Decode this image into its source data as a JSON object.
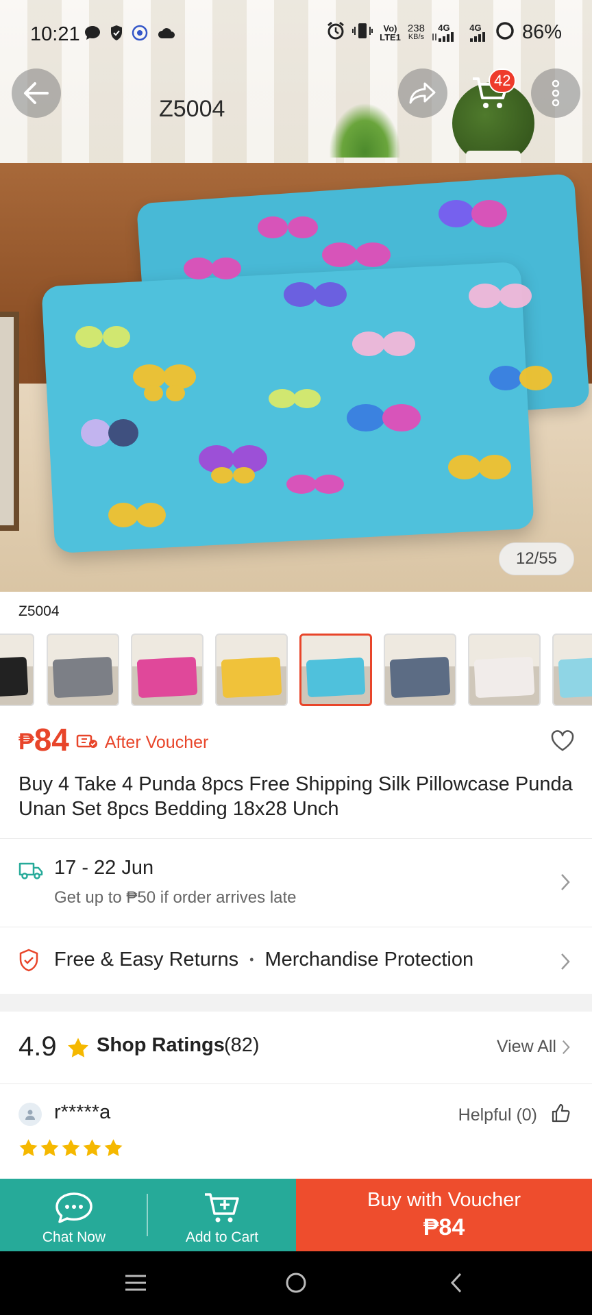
{
  "status_bar": {
    "time": "10:21",
    "battery": "86%",
    "net_speed_value": "238",
    "net_speed_unit": "KB/s",
    "volte_top": "Vo)",
    "volte_bottom": "LTE1",
    "sig1": "4G",
    "sig2": "4G"
  },
  "header": {
    "title": "Z5004",
    "cart_count": "42"
  },
  "gallery": {
    "counter": "12/55",
    "variant_label": "Z5004",
    "thumbnails": [
      {
        "color": "#222222",
        "selected": false
      },
      {
        "color": "#7c7f86",
        "selected": false
      },
      {
        "color": "#e0489a",
        "selected": false
      },
      {
        "color": "#f0c23a",
        "selected": false
      },
      {
        "color": "#4fc1dc",
        "selected": true
      },
      {
        "color": "#5c6c84",
        "selected": false
      },
      {
        "color": "#f1ecea",
        "selected": false
      },
      {
        "color": "#8fd5e5",
        "selected": false
      }
    ]
  },
  "price": {
    "currency": "₱",
    "value": "84",
    "after_voucher": "After Voucher"
  },
  "product": {
    "title": "Buy 4 Take 4 Punda 8pcs Free Shipping Silk Pillowcase Punda Unan Set 8pcs Bedding 18x28 Unch"
  },
  "shipping": {
    "date_range": "17 - 22 Jun",
    "guarantee": "Get up to ₱50 if order arrives late"
  },
  "returns": {
    "label_1": "Free & Easy Returns",
    "separator": "•",
    "label_2": "Merchandise Protection"
  },
  "ratings": {
    "score": "4.9",
    "label": "Shop Ratings",
    "count": "(82)",
    "view_all": "View All"
  },
  "review": {
    "reviewer": "r*****a",
    "helpful": "Helpful (0)",
    "stars": 5
  },
  "bottom_bar": {
    "chat_label": "Chat Now",
    "cart_label": "Add to Cart",
    "buy_line1": "Buy with Voucher",
    "buy_line2": "₱84"
  },
  "colors": {
    "accent": "#ee4d2d",
    "teal": "#26aa99",
    "star": "#f5b800"
  }
}
